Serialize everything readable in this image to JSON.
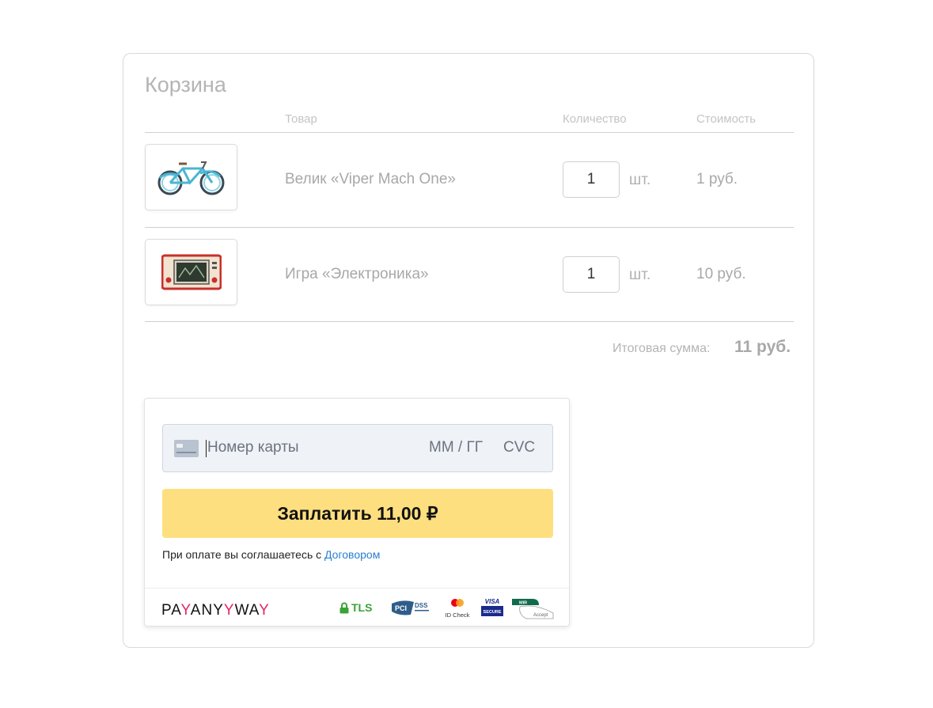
{
  "cart": {
    "title": "Корзина",
    "columns": {
      "product": "Товар",
      "quantity": "Количество",
      "price": "Стоимость"
    },
    "items": [
      {
        "name": "Велик «Viper Mach One»",
        "quantity": "1",
        "unit": "шт.",
        "price": "1 руб.",
        "image": "bicycle-image"
      },
      {
        "name": "Игра «Электроника»",
        "quantity": "1",
        "unit": "шт.",
        "price": "10 руб.",
        "image": "handheld-game-image"
      }
    ],
    "total_label": "Итоговая сумма:",
    "total_value": "11 руб."
  },
  "payment": {
    "card_number_placeholder": "Номер карты",
    "expiry_placeholder": "ММ / ГГ",
    "cvc_placeholder": "CVC",
    "pay_button": "Заплатить 11,00 ₽",
    "agreement_text": "При оплате вы соглашаетесь с",
    "agreement_link": "Договором",
    "brand_parts": [
      "PA",
      "Y",
      "ANY",
      "Y",
      "WA",
      "Y"
    ],
    "badges": {
      "tls": "TLS",
      "pci": "DSS",
      "idcheck": "ID Check",
      "visa": "VISA",
      "visa_sub": "SECURE",
      "mir": "MIR",
      "mir_sub": "Accept"
    },
    "colors": {
      "button": "#fedf80",
      "link": "#2a7fd0",
      "brand_accent": "#e0266b",
      "tls": "#3aa335"
    }
  }
}
